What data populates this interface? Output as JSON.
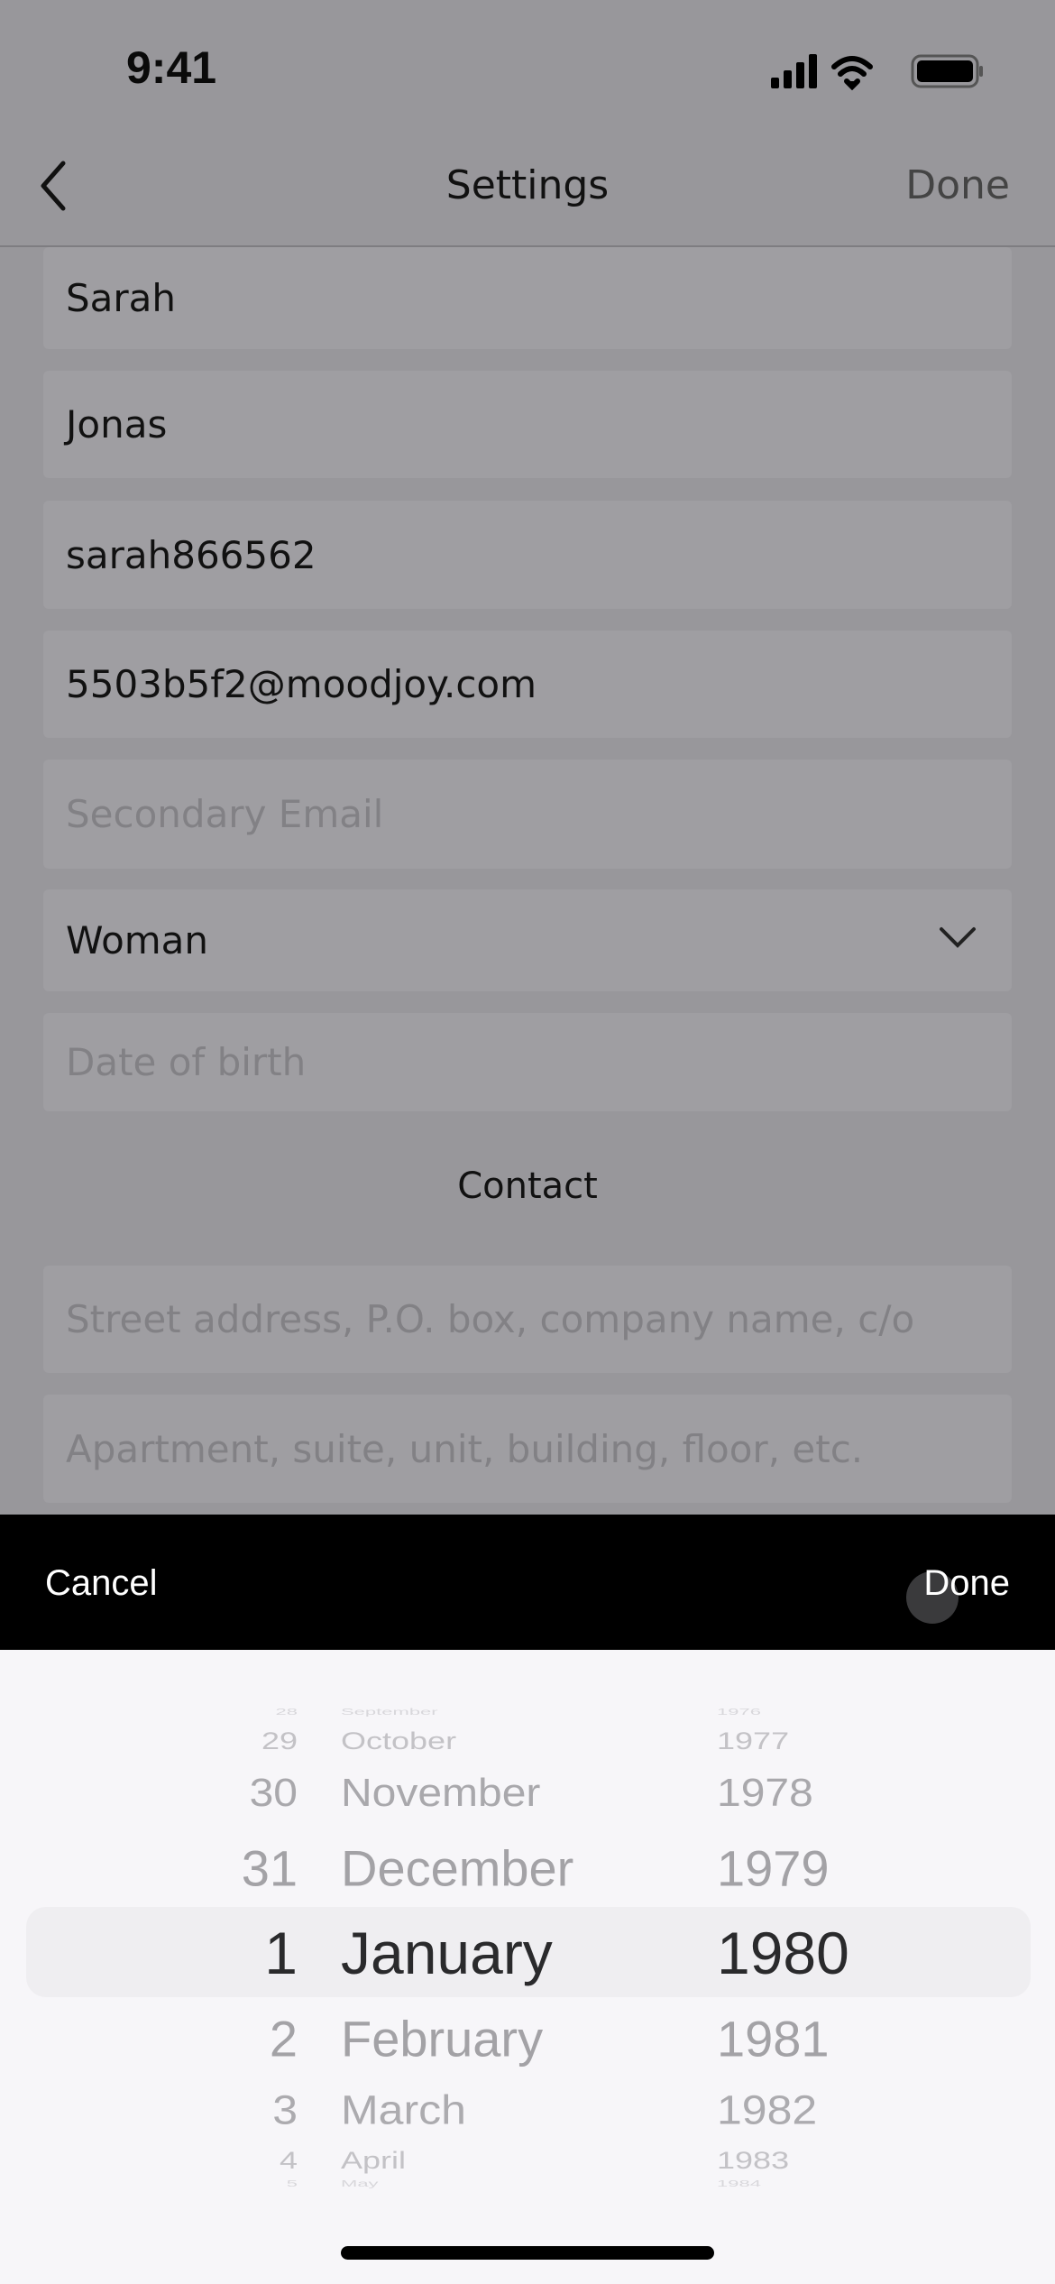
{
  "status_bar": {
    "time": "9:41",
    "icons": [
      "cellular-signal-icon",
      "wifi-icon",
      "battery-icon"
    ]
  },
  "nav": {
    "title": "Settings",
    "done_label": "Done",
    "back_icon": "chevron-left-icon"
  },
  "fields": [
    {
      "name": "first-name",
      "value": "Sarah",
      "placeholder": ""
    },
    {
      "name": "last-name",
      "value": "Jonas",
      "placeholder": ""
    },
    {
      "name": "username",
      "value": "sarah866562",
      "placeholder": ""
    },
    {
      "name": "email",
      "value": "5503b5f2@moodjoy.com",
      "placeholder": ""
    },
    {
      "name": "secondary-email",
      "value": "",
      "placeholder": "Secondary Email"
    },
    {
      "name": "gender",
      "value": "Woman",
      "placeholder": ""
    },
    {
      "name": "date-of-birth",
      "value": "",
      "placeholder": "Date of birth"
    }
  ],
  "contact": {
    "heading": "Contact",
    "street_placeholder": "Street address, P.O. box, company name, c/o",
    "apt_placeholder": "Apartment, suite, unit, building, floor, etc."
  },
  "toolbar": {
    "cancel_label": "Cancel",
    "done_label": "Done"
  },
  "picker": {
    "days": [
      "28",
      "29",
      "30",
      "31",
      "1",
      "2",
      "3",
      "4",
      "5"
    ],
    "months": [
      "September",
      "October",
      "November",
      "December",
      "January",
      "February",
      "March",
      "April",
      "May"
    ],
    "years": [
      "1976",
      "1977",
      "1978",
      "1979",
      "1980",
      "1981",
      "1982",
      "1983",
      "1984"
    ],
    "selected": {
      "day": "1",
      "month": "January",
      "year": "1980"
    }
  }
}
